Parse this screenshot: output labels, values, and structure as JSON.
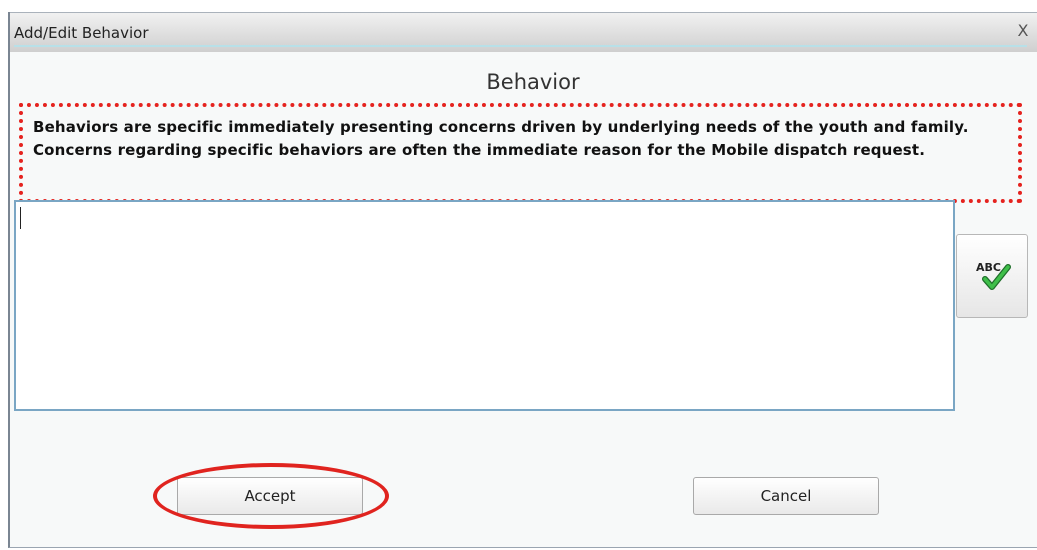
{
  "dialog": {
    "title": "Add/Edit Behavior",
    "close_label": "X"
  },
  "section": {
    "heading": "Behavior",
    "description": "Behaviors are specific immediately presenting concerns driven by underlying needs of the youth and family. Concerns regarding specific behaviors are often the immediate reason for the Mobile dispatch request."
  },
  "behavior_input": {
    "value": "",
    "placeholder": ""
  },
  "spellcheck": {
    "icon": "spellcheck-icon",
    "icon_text": "ABC"
  },
  "buttons": {
    "accept_label": "Accept",
    "cancel_label": "Cancel"
  },
  "colors": {
    "annotation_red": "#e5231f",
    "input_border": "#7aa6c4",
    "check_green": "#2e9e36"
  }
}
